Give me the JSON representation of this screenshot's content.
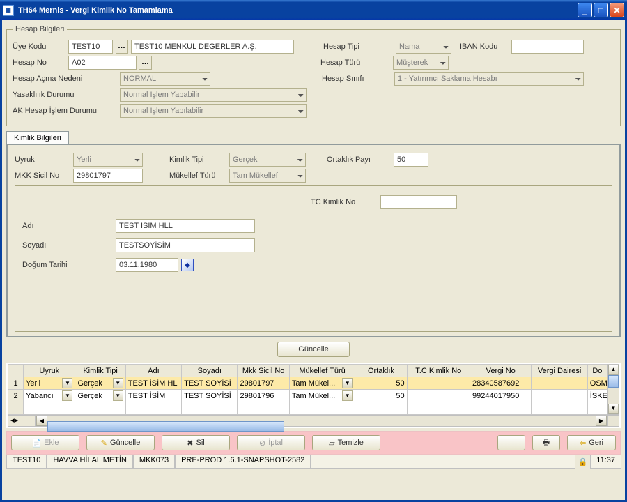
{
  "window": {
    "title": "TH64 Mernis - Vergi  Kimlik No Tamamlama"
  },
  "hesap": {
    "legend": "Hesap Bilgileri",
    "uye_kodu_lbl": "Üye Kodu",
    "uye_kodu": "TEST10",
    "uye_ad": "TEST10 MENKUL DEĞERLER A.Ş.",
    "hesap_tipi_lbl": "Hesap Tipi",
    "hesap_tipi": "Nama",
    "iban_lbl": "IBAN Kodu",
    "iban": "",
    "hesap_no_lbl": "Hesap No",
    "hesap_no": "A02",
    "hesap_turu_lbl": "Hesap Türü",
    "hesap_turu": "Müşterek",
    "acma_lbl": "Hesap Açma Nedeni",
    "acma": "NORMAL",
    "sinif_lbl": "Hesap Sınıfı",
    "sinif": "1 - Yatırımcı Saklama Hesabı",
    "yasak_lbl": "Yasaklılık Durumu",
    "yasak": "Normal İşlem Yapabilir",
    "ak_lbl": "AK Hesap İşlem Durumu",
    "ak": "Normal İşlem Yapılabilir"
  },
  "tab": {
    "label": "Kimlik Bilgileri"
  },
  "kimlik": {
    "uyruk_lbl": "Uyruk",
    "uyruk": "Yerli",
    "tip_lbl": "Kimlik Tipi",
    "tip": "Gerçek",
    "ortaklik_lbl": "Ortaklık Payı",
    "ortaklik": "50",
    "mkk_lbl": "MKK Sicil No",
    "mkk": "29801797",
    "mukellef_lbl": "Mükellef Türü",
    "mukellef": "Tam Mükellef",
    "tc_lbl": "TC Kimlik No",
    "tc": "",
    "adi_lbl": "Adı",
    "adi": "TEST İSİM HLL",
    "soyadi_lbl": "Soyadı",
    "soyadi": "TESTSOYİSİM",
    "dogum_lbl": "Doğum Tarihi",
    "dogum": "03.11.1980"
  },
  "guncelle_btn": "Güncelle",
  "grid": {
    "headers": [
      "Uyruk",
      "Kimlik Tipi",
      "Adı",
      "Soyadı",
      "Mkk Sicil No",
      "Mükellef Türü",
      "Ortaklık",
      "T.C Kimlik No",
      "Vergi No",
      "Vergi Dairesi",
      "Do"
    ],
    "rows": [
      {
        "n": "1",
        "uyruk": "Yerli",
        "tip": "Gerçek",
        "adi": "TEST İSİM HL",
        "soyadi": "TEST SOYİSİ",
        "mkk": "29801797",
        "muk": "Tam Mükel...",
        "ort": "50",
        "tc": "",
        "vergi": "28340587692",
        "daire": "",
        "do": "OSM"
      },
      {
        "n": "2",
        "uyruk": "Yabancı",
        "tip": "Gerçek",
        "adi": "TEST İSİM",
        "soyadi": "TEST SOYİSİ",
        "mkk": "29801796",
        "muk": "Tam Mükel...",
        "ort": "50",
        "tc": "",
        "vergi": "99244017950",
        "daire": "",
        "do": "İSKE"
      }
    ]
  },
  "actions": {
    "ekle": "Ekle",
    "guncelle": "Güncelle",
    "sil": "Sil",
    "iptal": "İptal",
    "temizle": "Temizle",
    "geri": "Geri"
  },
  "status": {
    "s1": "TEST10",
    "s2": "HAVVA HİLAL METİN",
    "s3": "MKK073",
    "s4": "PRE-PROD 1.6.1-SNAPSHOT-2582",
    "time": "11:37"
  }
}
